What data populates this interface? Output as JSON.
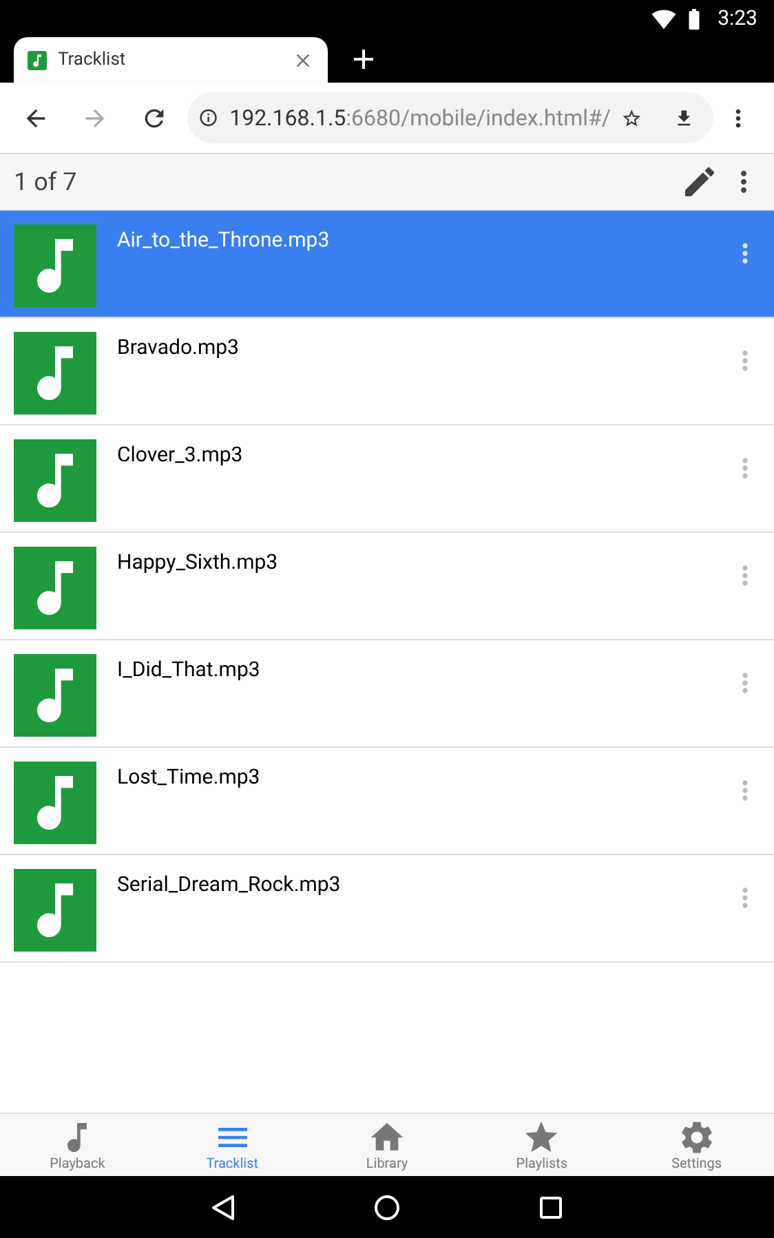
{
  "status_bar": {
    "time": "3:23"
  },
  "browser_tab": {
    "title": "Tracklist"
  },
  "address_bar": {
    "host": "192.168.1.5",
    "path": ":6680/mobile/index.html#/"
  },
  "header": {
    "position": "1 of 7"
  },
  "tracks": [
    {
      "name": "Air_to_the_Throne.mp3",
      "selected": true
    },
    {
      "name": "Bravado.mp3",
      "selected": false
    },
    {
      "name": "Clover_3.mp3",
      "selected": false
    },
    {
      "name": "Happy_Sixth.mp3",
      "selected": false
    },
    {
      "name": "I_Did_That.mp3",
      "selected": false
    },
    {
      "name": "Lost_Time.mp3",
      "selected": false
    },
    {
      "name": "Serial_Dream_Rock.mp3",
      "selected": false
    }
  ],
  "bottom_nav": [
    {
      "kind": "playback",
      "label": "Playback",
      "selected": false
    },
    {
      "kind": "tracklist",
      "label": "Tracklist",
      "selected": true
    },
    {
      "kind": "library",
      "label": "Library",
      "selected": false
    },
    {
      "kind": "playlists",
      "label": "Playlists",
      "selected": false
    },
    {
      "kind": "settings",
      "label": "Settings",
      "selected": false
    }
  ]
}
